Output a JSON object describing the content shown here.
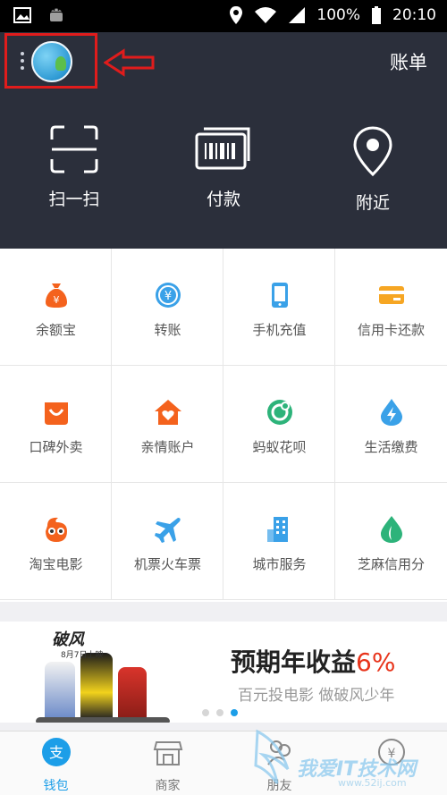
{
  "status_bar": {
    "battery_text": "100%",
    "time": "20:10",
    "icons": [
      "image-icon",
      "android-icon",
      "location-icon",
      "wifi-icon",
      "signal-icon",
      "battery-icon"
    ]
  },
  "header": {
    "bill_label": "账单",
    "menu_icon": "kebab-menu-icon",
    "highlight_color": "#e01c1c"
  },
  "quick_actions": [
    {
      "label": "扫一扫",
      "icon": "scan-icon"
    },
    {
      "label": "付款",
      "icon": "barcode-pay-icon"
    },
    {
      "label": "附近",
      "icon": "location-pin-icon"
    }
  ],
  "services": [
    {
      "label": "余额宝",
      "icon": "money-bag-icon",
      "color": "#f4621d"
    },
    {
      "label": "转账",
      "icon": "transfer-icon",
      "color": "#3aa1e8"
    },
    {
      "label": "手机充值",
      "icon": "phone-icon",
      "color": "#3aa1e8"
    },
    {
      "label": "信用卡还款",
      "icon": "credit-card-icon",
      "color": "#f6a623"
    },
    {
      "label": "口碑外卖",
      "icon": "smile-bag-icon",
      "color": "#f4621d"
    },
    {
      "label": "亲情账户",
      "icon": "house-heart-icon",
      "color": "#f4621d"
    },
    {
      "label": "蚂蚁花呗",
      "icon": "huabei-icon",
      "color": "#2db37a"
    },
    {
      "label": "生活缴费",
      "icon": "lightning-icon",
      "color": "#3aa1e8"
    },
    {
      "label": "淘宝电影",
      "icon": "glasses-mascot-icon",
      "color": "#f4621d"
    },
    {
      "label": "机票火车票",
      "icon": "airplane-icon",
      "color": "#3aa1e8"
    },
    {
      "label": "城市服务",
      "icon": "building-icon",
      "color": "#3aa1e8"
    },
    {
      "label": "芝麻信用分",
      "icon": "sesame-icon",
      "color": "#2db37a"
    }
  ],
  "banner": {
    "film_title": "破风",
    "film_date": "8月7日上映",
    "headline": "预期年收益",
    "headline_pct": "6%",
    "subline": "百元投电影 做破风少年",
    "dots_total": 3,
    "dots_active": 3
  },
  "tab_bar": [
    {
      "label": "钱包",
      "icon": "wallet-icon",
      "active": true
    },
    {
      "label": "商家",
      "icon": "store-icon",
      "active": false
    },
    {
      "label": "朋友",
      "icon": "friends-icon",
      "active": false
    },
    {
      "label": "",
      "icon": "money-icon",
      "active": false
    }
  ],
  "watermark": {
    "text": "我爱IT技术网",
    "url": "www.52ij.com"
  },
  "colors": {
    "header_bg": "#2b2f3b",
    "accent": "#1c9ee8",
    "promo_red": "#e8341b"
  }
}
